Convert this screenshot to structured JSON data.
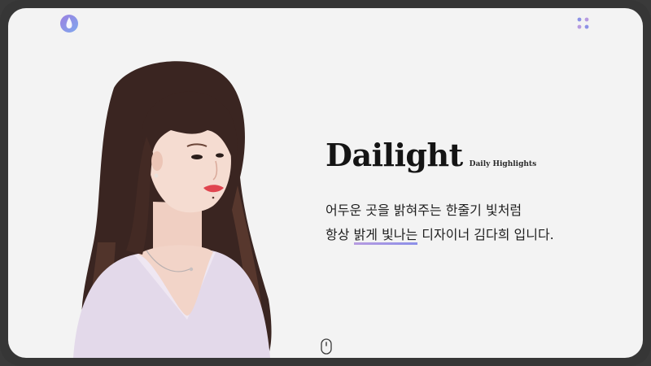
{
  "header": {
    "logo_icon": "drop-logo-icon",
    "menu_icon": "four-dots-menu-icon"
  },
  "hero": {
    "title": "Dailight",
    "subtitle": "Daily Highlights",
    "line1": "어두운 곳을 밝혀주는 한줄기 빛처럼",
    "line2_pre": "항상 ",
    "line2_highlight": "밝게 빛나는",
    "line2_post": " 디자이너 김다희 입니다."
  },
  "scroll_icon": "mouse-scroll-icon",
  "colors": {
    "accent_purple": "#b79be0",
    "accent_blue": "#8b8fe8",
    "background": "#f3f3f3"
  }
}
